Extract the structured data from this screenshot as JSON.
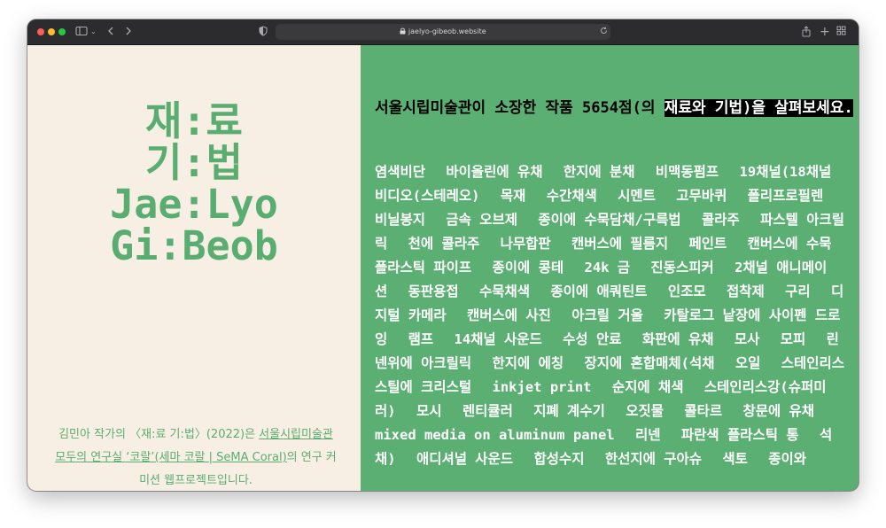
{
  "browser": {
    "url": "jaelyo-gibeob.website"
  },
  "colors": {
    "accent_green": "#5baf72",
    "cream": "#f8efe4"
  },
  "left": {
    "title_lines": [
      "재:료",
      "기:법",
      "Jae:Lyo",
      "Gi:Beob"
    ],
    "desc": {
      "part1": "김민아 작가의 〈재:료 기:법〉(2022)은 ",
      "link1": "서울시립미술관 모두의 연구실 ‘코랄’(세마 코랄 | SeMA Coral)",
      "part2": "의 연구 커미션 웹프로젝트입니다."
    }
  },
  "right": {
    "headline_plain": "서울시립미술관이 소장한 작품 5654점(의 ",
    "headline_highlight": "재료와 기법)을 살펴보세요.",
    "materials": [
      "염색비단",
      "바이올린에 유채",
      "한지에 분채",
      "비맥동펌프",
      "19채널(18채널 비디오(스테레오)",
      "목재",
      "수간채색",
      "시멘트",
      "고무바퀴",
      "폴리프로필렌",
      "비닐봉지",
      "금속 오브제",
      "종이에 수묵담채/구륵법",
      "콜라주",
      "파스텔 아크릴릭",
      "천에 콜라주",
      "나무합판",
      "캔버스에 필름지",
      "페인트",
      "캔버스에 수묵",
      "플라스틱 파이프",
      "종이에 콩테",
      "24k 금",
      "진동스피커",
      "2채널 애니메이션",
      "동판용접",
      "수묵채색",
      "종이에 애쿼틴트",
      "인조모",
      "접착제",
      "구리",
      "디지털 카메라",
      "캔버스에 사진",
      "아크릴 거울",
      "카탈로그 낱장에 사이펜 드로잉",
      "램프",
      "14채널 사운드",
      "수성 안료",
      "화판에 유채",
      "모사",
      "모피",
      "린넨위에 아크릴릭",
      "한지에 에칭",
      "장지에 혼합매체(석채",
      "오일",
      "스테인리스 스틸에 크리스털",
      "inkjet print",
      "순지에 채색",
      "스테인리스강(슈퍼미러)",
      "모시",
      "렌티큘러",
      "지폐 계수기",
      "오짓물",
      "콜타르",
      "창문에 유채",
      "mixed media on aluminum panel",
      "리넨",
      "파란색 플라스틱 통",
      "석채)",
      "애디셔널 사운드",
      "합성수지",
      "한선지에 구아슈",
      "색토",
      "종이와"
    ]
  }
}
